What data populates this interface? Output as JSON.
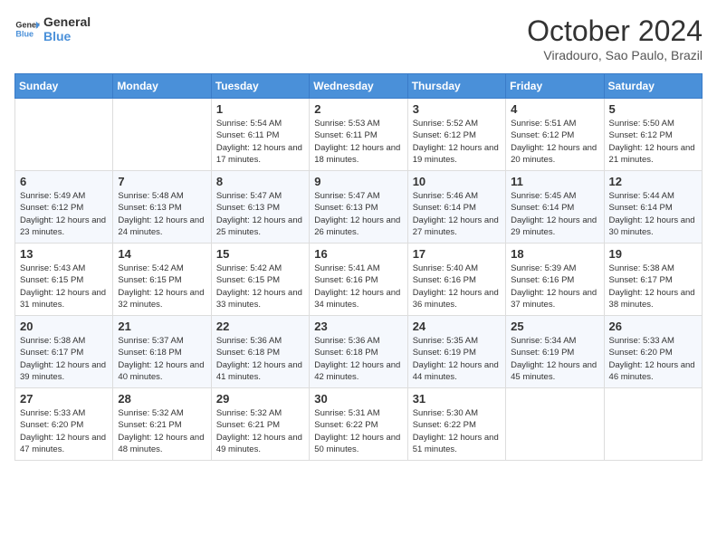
{
  "header": {
    "logo_general": "General",
    "logo_blue": "Blue",
    "month_title": "October 2024",
    "location": "Viradouro, Sao Paulo, Brazil"
  },
  "days_of_week": [
    "Sunday",
    "Monday",
    "Tuesday",
    "Wednesday",
    "Thursday",
    "Friday",
    "Saturday"
  ],
  "weeks": [
    [
      {
        "day": "",
        "info": ""
      },
      {
        "day": "",
        "info": ""
      },
      {
        "day": "1",
        "info": "Sunrise: 5:54 AM\nSunset: 6:11 PM\nDaylight: 12 hours and 17 minutes."
      },
      {
        "day": "2",
        "info": "Sunrise: 5:53 AM\nSunset: 6:11 PM\nDaylight: 12 hours and 18 minutes."
      },
      {
        "day": "3",
        "info": "Sunrise: 5:52 AM\nSunset: 6:12 PM\nDaylight: 12 hours and 19 minutes."
      },
      {
        "day": "4",
        "info": "Sunrise: 5:51 AM\nSunset: 6:12 PM\nDaylight: 12 hours and 20 minutes."
      },
      {
        "day": "5",
        "info": "Sunrise: 5:50 AM\nSunset: 6:12 PM\nDaylight: 12 hours and 21 minutes."
      }
    ],
    [
      {
        "day": "6",
        "info": "Sunrise: 5:49 AM\nSunset: 6:12 PM\nDaylight: 12 hours and 23 minutes."
      },
      {
        "day": "7",
        "info": "Sunrise: 5:48 AM\nSunset: 6:13 PM\nDaylight: 12 hours and 24 minutes."
      },
      {
        "day": "8",
        "info": "Sunrise: 5:47 AM\nSunset: 6:13 PM\nDaylight: 12 hours and 25 minutes."
      },
      {
        "day": "9",
        "info": "Sunrise: 5:47 AM\nSunset: 6:13 PM\nDaylight: 12 hours and 26 minutes."
      },
      {
        "day": "10",
        "info": "Sunrise: 5:46 AM\nSunset: 6:14 PM\nDaylight: 12 hours and 27 minutes."
      },
      {
        "day": "11",
        "info": "Sunrise: 5:45 AM\nSunset: 6:14 PM\nDaylight: 12 hours and 29 minutes."
      },
      {
        "day": "12",
        "info": "Sunrise: 5:44 AM\nSunset: 6:14 PM\nDaylight: 12 hours and 30 minutes."
      }
    ],
    [
      {
        "day": "13",
        "info": "Sunrise: 5:43 AM\nSunset: 6:15 PM\nDaylight: 12 hours and 31 minutes."
      },
      {
        "day": "14",
        "info": "Sunrise: 5:42 AM\nSunset: 6:15 PM\nDaylight: 12 hours and 32 minutes."
      },
      {
        "day": "15",
        "info": "Sunrise: 5:42 AM\nSunset: 6:15 PM\nDaylight: 12 hours and 33 minutes."
      },
      {
        "day": "16",
        "info": "Sunrise: 5:41 AM\nSunset: 6:16 PM\nDaylight: 12 hours and 34 minutes."
      },
      {
        "day": "17",
        "info": "Sunrise: 5:40 AM\nSunset: 6:16 PM\nDaylight: 12 hours and 36 minutes."
      },
      {
        "day": "18",
        "info": "Sunrise: 5:39 AM\nSunset: 6:16 PM\nDaylight: 12 hours and 37 minutes."
      },
      {
        "day": "19",
        "info": "Sunrise: 5:38 AM\nSunset: 6:17 PM\nDaylight: 12 hours and 38 minutes."
      }
    ],
    [
      {
        "day": "20",
        "info": "Sunrise: 5:38 AM\nSunset: 6:17 PM\nDaylight: 12 hours and 39 minutes."
      },
      {
        "day": "21",
        "info": "Sunrise: 5:37 AM\nSunset: 6:18 PM\nDaylight: 12 hours and 40 minutes."
      },
      {
        "day": "22",
        "info": "Sunrise: 5:36 AM\nSunset: 6:18 PM\nDaylight: 12 hours and 41 minutes."
      },
      {
        "day": "23",
        "info": "Sunrise: 5:36 AM\nSunset: 6:18 PM\nDaylight: 12 hours and 42 minutes."
      },
      {
        "day": "24",
        "info": "Sunrise: 5:35 AM\nSunset: 6:19 PM\nDaylight: 12 hours and 44 minutes."
      },
      {
        "day": "25",
        "info": "Sunrise: 5:34 AM\nSunset: 6:19 PM\nDaylight: 12 hours and 45 minutes."
      },
      {
        "day": "26",
        "info": "Sunrise: 5:33 AM\nSunset: 6:20 PM\nDaylight: 12 hours and 46 minutes."
      }
    ],
    [
      {
        "day": "27",
        "info": "Sunrise: 5:33 AM\nSunset: 6:20 PM\nDaylight: 12 hours and 47 minutes."
      },
      {
        "day": "28",
        "info": "Sunrise: 5:32 AM\nSunset: 6:21 PM\nDaylight: 12 hours and 48 minutes."
      },
      {
        "day": "29",
        "info": "Sunrise: 5:32 AM\nSunset: 6:21 PM\nDaylight: 12 hours and 49 minutes."
      },
      {
        "day": "30",
        "info": "Sunrise: 5:31 AM\nSunset: 6:22 PM\nDaylight: 12 hours and 50 minutes."
      },
      {
        "day": "31",
        "info": "Sunrise: 5:30 AM\nSunset: 6:22 PM\nDaylight: 12 hours and 51 minutes."
      },
      {
        "day": "",
        "info": ""
      },
      {
        "day": "",
        "info": ""
      }
    ]
  ]
}
